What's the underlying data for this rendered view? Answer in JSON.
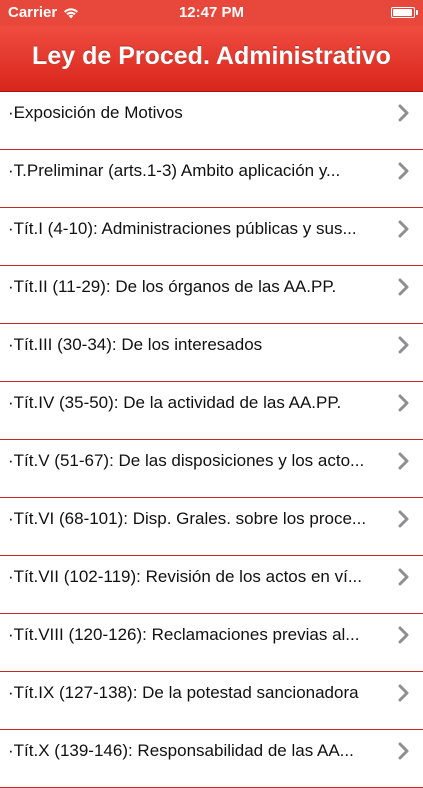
{
  "status_bar": {
    "carrier": "Carrier",
    "time": "12:47 PM",
    "icons": [
      "wifi-icon",
      "battery-icon"
    ]
  },
  "nav": {
    "title": "Ley de Proced. Administrativo"
  },
  "colors": {
    "accent": "#e8483c",
    "separator": "#c8281f",
    "chevron": "#8e8e93"
  },
  "list": {
    "items": [
      {
        "label": "·Exposición de Motivos"
      },
      {
        "label": "·T.Preliminar (arts.1-3) Ambito aplicación y..."
      },
      {
        "label": "·Tít.I (4-10): Administraciones públicas y sus..."
      },
      {
        "label": "·Tít.II (11-29): De los órganos de las AA.PP."
      },
      {
        "label": "·Tít.III (30-34): De los interesados"
      },
      {
        "label": "·Tít.IV (35-50): De la actividad de las AA.PP."
      },
      {
        "label": "·Tít.V (51-67): De las disposiciones y los acto..."
      },
      {
        "label": "·Tít.VI (68-101): Disp. Grales. sobre los proce..."
      },
      {
        "label": "·Tít.VII (102-119): Revisión de los actos en ví..."
      },
      {
        "label": "·Tít.VIII (120-126): Reclamaciones previas al..."
      },
      {
        "label": "·Tít.IX (127-138): De la potestad sancionadora"
      },
      {
        "label": "·Tít.X (139-146): Responsabilidad de las AA..."
      }
    ]
  }
}
